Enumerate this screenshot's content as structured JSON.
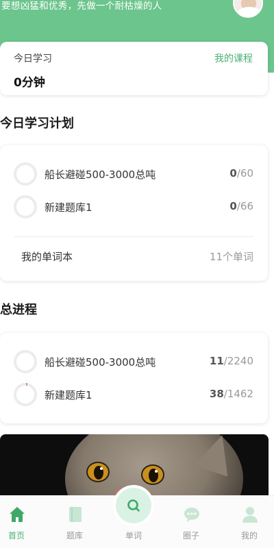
{
  "header": {
    "motto": "要想凶猛和优秀，先做一个耐枯燥的人"
  },
  "today": {
    "label": "今日学习",
    "my_course": "我的课程",
    "minutes": "0分钟"
  },
  "plan": {
    "title": "今日学习计划",
    "items": [
      {
        "name": "船长避碰500-3000总吨",
        "done": "0",
        "total": "/60"
      },
      {
        "name": "新建题库1",
        "done": "0",
        "total": "/66"
      }
    ],
    "wordbook_label": "我的单词本",
    "wordbook_count": "11个单词"
  },
  "progress": {
    "title": "总进程",
    "items": [
      {
        "name": "船长避碰500-3000总吨",
        "done": "11",
        "total": "/2240"
      },
      {
        "name": "新建题库1",
        "done": "38",
        "total": "/1462"
      }
    ]
  },
  "tabbar": {
    "items": [
      {
        "label": "首页",
        "icon": "home-icon",
        "active": true
      },
      {
        "label": "题库",
        "icon": "book-icon",
        "active": false
      },
      {
        "label": "单词",
        "icon": "search-icon",
        "active": false
      },
      {
        "label": "圈子",
        "icon": "chat-icon",
        "active": false
      },
      {
        "label": "我的",
        "icon": "user-icon",
        "active": false
      }
    ]
  },
  "colors": {
    "brand_green": "#6cc58d",
    "active_tab": "#4caf74",
    "accent_text": "#4caf74"
  }
}
